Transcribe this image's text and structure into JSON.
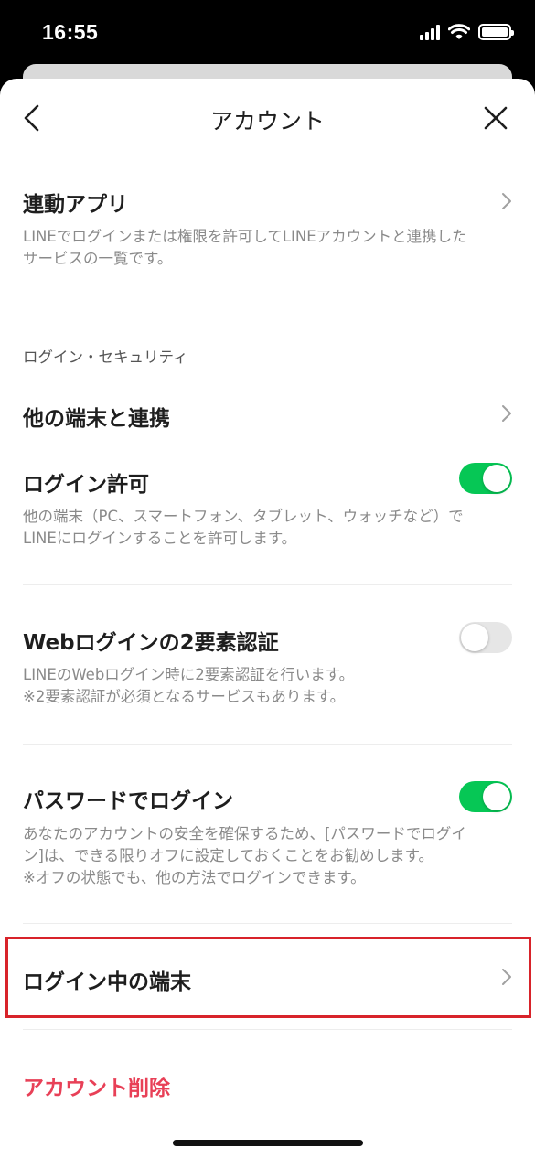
{
  "status_bar": {
    "time": "16:55"
  },
  "nav": {
    "title": "アカウント"
  },
  "linked_apps": {
    "title": "連動アプリ",
    "description_line1": "LINEでログインまたは権限を許可してLINEアカウントと連携した",
    "description_line2": "サービスの一覧です。"
  },
  "section_header": "ログイン・セキュリティ",
  "other_devices": {
    "title": "他の端末と連携"
  },
  "login_permission": {
    "title": "ログイン許可",
    "description_line1": "他の端末（PC、スマートフォン、タブレット、ウォッチなど）で",
    "description_line2": "LINEにログインすることを許可します。",
    "enabled": true
  },
  "web_2fa": {
    "title": "Webログインの2要素認証",
    "description_line1": "LINEのWebログイン時に2要素認証を行います。",
    "description_line2": "※2要素認証が必須となるサービスもあります。",
    "enabled": false
  },
  "password_login": {
    "title": "パスワードでログイン",
    "description_line1": "あなたのアカウントの安全を確保するため、[パスワードでログイ",
    "description_line2": "ン]は、できる限りオフに設定しておくことをお勧めします。",
    "description_line3": "※オフの状態でも、他の方法でログインできます。",
    "enabled": true
  },
  "logged_in_devices": {
    "title": "ログイン中の端末"
  },
  "delete_account": {
    "title": "アカウント削除"
  },
  "colors": {
    "toggle_on": "#06c755",
    "toggle_off": "#e6e6e6",
    "danger": "#e84057",
    "highlight": "#d8232a"
  }
}
